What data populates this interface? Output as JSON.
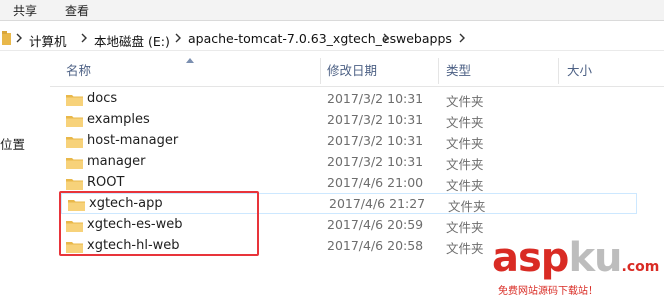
{
  "ribbon": {
    "tabs": [
      "共享",
      "查看"
    ]
  },
  "address_bar": {
    "crumbs": [
      "计算机",
      "本地磁盘 (E:)",
      "apache-tomcat-7.0.63_xgtech_es",
      "webapps"
    ]
  },
  "navigation_pane": {
    "visible_label": "位置"
  },
  "columns": {
    "name": "名称",
    "modified": "修改日期",
    "type": "类型",
    "size": "大小"
  },
  "files": [
    {
      "name": "docs",
      "modified": "2017/3/2 10:31",
      "type": "文件夹"
    },
    {
      "name": "examples",
      "modified": "2017/3/2 10:31",
      "type": "文件夹"
    },
    {
      "name": "host-manager",
      "modified": "2017/3/2 10:31",
      "type": "文件夹"
    },
    {
      "name": "manager",
      "modified": "2017/3/2 10:31",
      "type": "文件夹"
    },
    {
      "name": "ROOT",
      "modified": "2017/4/6 21:00",
      "type": "文件夹"
    },
    {
      "name": "xgtech-app",
      "modified": "2017/4/6 21:27",
      "type": "文件夹"
    },
    {
      "name": "xgtech-es-web",
      "modified": "2017/4/6 20:59",
      "type": "文件夹"
    },
    {
      "name": "xgtech-hl-web",
      "modified": "2017/4/6 20:58",
      "type": "文件夹"
    }
  ],
  "icons": {
    "folder": "folder-icon",
    "breadcrumb_separator": "chevron-right-icon",
    "sort": "sort-ascending-icon"
  },
  "colors": {
    "highlight_box": "#e8343a",
    "folder": "#e9b84a",
    "header_text": "#4d6185"
  },
  "watermark": {
    "main": "aspku",
    "main_red": "asp",
    "main_gray": "ku",
    "tld": ".com",
    "subtitle": "免费网站源码下载站！"
  }
}
